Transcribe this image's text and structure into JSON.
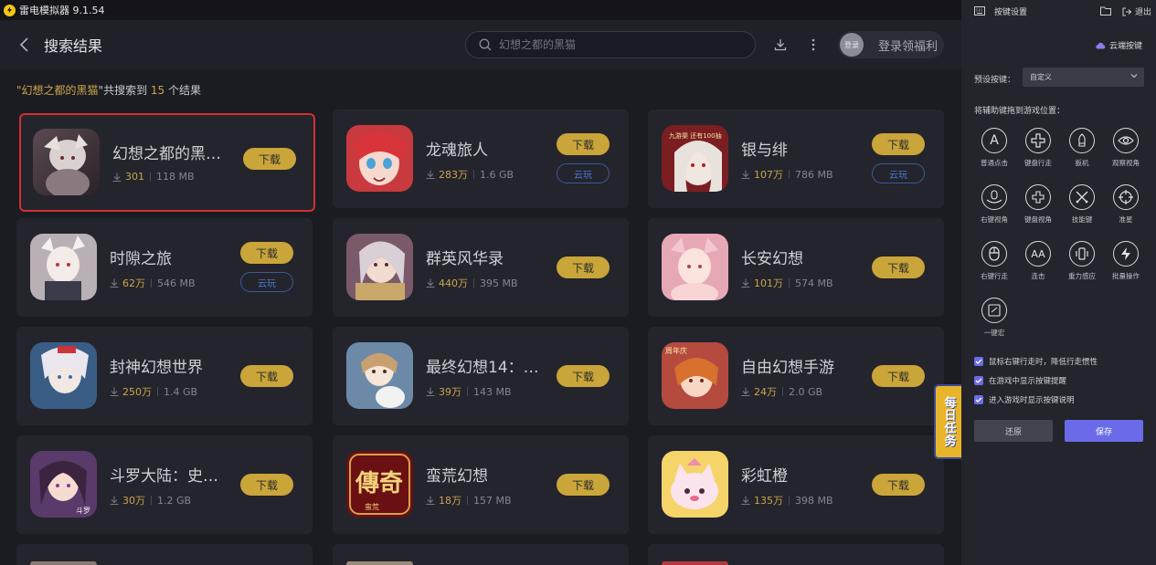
{
  "titlebar": {
    "app_title": "雷电模拟器 9.1.54"
  },
  "header": {
    "title": "搜索结果",
    "search_placeholder": "幻想之都的黑猫",
    "login_avatar_text": "登录",
    "login_label": "登录领福利"
  },
  "summary": {
    "prefix_quote": "\"",
    "keyword": "幻想之都的黑猫",
    "mid": "\"共搜索到 ",
    "count": "15",
    "suffix": " 个结果"
  },
  "results": [
    {
      "name": "幻想之都的黑…",
      "downloads": "301",
      "size": "118 MB",
      "download_label": "下载",
      "cloud_label": ""
    },
    {
      "name": "龙魂旅人",
      "downloads": "283万",
      "size": "1.6 GB",
      "download_label": "下载",
      "cloud_label": "云玩"
    },
    {
      "name": "银与绯",
      "downloads": "107万",
      "size": "786 MB",
      "download_label": "下载",
      "cloud_label": "云玩"
    },
    {
      "name": "时隙之旅",
      "downloads": "62万",
      "size": "546 MB",
      "download_label": "下载",
      "cloud_label": "云玩"
    },
    {
      "name": "群英风华录",
      "downloads": "440万",
      "size": "395 MB",
      "download_label": "下载",
      "cloud_label": ""
    },
    {
      "name": "长安幻想",
      "downloads": "101万",
      "size": "574 MB",
      "download_label": "下载",
      "cloud_label": ""
    },
    {
      "name": "封神幻想世界",
      "downloads": "250万",
      "size": "1.4 GB",
      "download_label": "下载",
      "cloud_label": ""
    },
    {
      "name": "最终幻想14：…",
      "downloads": "39万",
      "size": "143 MB",
      "download_label": "下载",
      "cloud_label": ""
    },
    {
      "name": "自由幻想手游",
      "downloads": "24万",
      "size": "2.0 GB",
      "download_label": "下载",
      "cloud_label": ""
    },
    {
      "name": "斗罗大陆：史…",
      "downloads": "30万",
      "size": "1.2 GB",
      "download_label": "下载",
      "cloud_label": ""
    },
    {
      "name": "蛮荒幻想",
      "downloads": "18万",
      "size": "157 MB",
      "download_label": "下载",
      "cloud_label": ""
    },
    {
      "name": "彩虹橙",
      "downloads": "135万",
      "size": "398 MB",
      "download_label": "下载",
      "cloud_label": ""
    }
  ],
  "icon_texts": {
    "silver": "九游渠 还有100抽",
    "ff": "",
    "free": "周年庆",
    "douluo": "斗罗",
    "chuanqi": "傳奇",
    "chuanqi_sub": "蛮荒"
  },
  "daily_task": "每日任务",
  "panel": {
    "title": "按键设置",
    "exit": "退出",
    "cloud_keys": "云端按键",
    "preset_label": "预设按键：",
    "preset_value": "自定义",
    "drag_hint": "将辅助键拖到游戏位置：",
    "keys": [
      {
        "glyph": "A",
        "label": "普通点击"
      },
      {
        "glyph": "",
        "label": "键盘行走"
      },
      {
        "glyph": "",
        "label": "扳机"
      },
      {
        "glyph": "",
        "label": "观察视角"
      },
      {
        "glyph": "",
        "label": "右键视角"
      },
      {
        "glyph": "",
        "label": "键盘视角"
      },
      {
        "glyph": "",
        "label": "技能键"
      },
      {
        "glyph": "",
        "label": "准星"
      },
      {
        "glyph": "",
        "label": "右键行走"
      },
      {
        "glyph": "AA",
        "label": "连击"
      },
      {
        "glyph": "",
        "label": "重力感应"
      },
      {
        "glyph": "",
        "label": "批量操作"
      },
      {
        "glyph": "",
        "label": "一键宏"
      }
    ],
    "checkboxes": [
      "鼠标右键行走时，降低行走惯性",
      "在游戏中显示按键提醒",
      "进入游戏时显示按键说明"
    ],
    "restore": "还原",
    "save": "保存"
  },
  "colors": {
    "accent_gold": "#c9a53a",
    "cloud_blue": "#4a7bd4",
    "panel_purple": "#6b6bea",
    "select_red": "#d23030"
  }
}
